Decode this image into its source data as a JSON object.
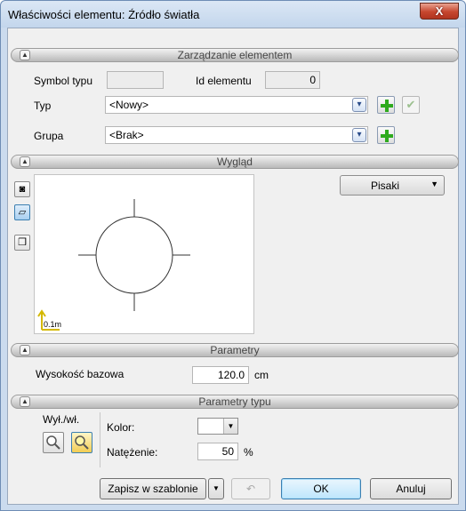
{
  "window": {
    "title": "Właściwości elementu: Źródło światła",
    "close_glyph": "X"
  },
  "sections": {
    "management": "Zarządzanie elementem",
    "appearance": "Wygląd",
    "parameters": "Parametry",
    "type_parameters": "Parametry typu"
  },
  "management": {
    "symbol_label": "Symbol typu",
    "symbol_value": "",
    "id_label": "Id elementu",
    "id_value": "0",
    "type_label": "Typ",
    "type_value": "<Nowy>",
    "group_label": "Grupa",
    "group_value": "<Brak>"
  },
  "appearance": {
    "pens_button": "Pisaki",
    "scale_label": "0.1m",
    "view_buttons": [
      "camera-icon",
      "plan-view-icon",
      "3d-view-icon"
    ]
  },
  "parameters": {
    "base_height_label": "Wysokość bazowa",
    "base_height_value": "120.0",
    "base_height_unit": "cm"
  },
  "type_parameters": {
    "on_off_label": "Wył./wł.",
    "color_label": "Kolor:",
    "color_value": "#ffffff",
    "intensity_label": "Natężenie:",
    "intensity_value": "50",
    "intensity_unit": "%"
  },
  "footer": {
    "save_template": "Zapisz w szablonie",
    "ok": "OK",
    "cancel": "Anuluj"
  },
  "colors": {
    "accent": "#3c7fb1",
    "green": "#2eaa1d",
    "scale_arrow": "#d4b800"
  }
}
